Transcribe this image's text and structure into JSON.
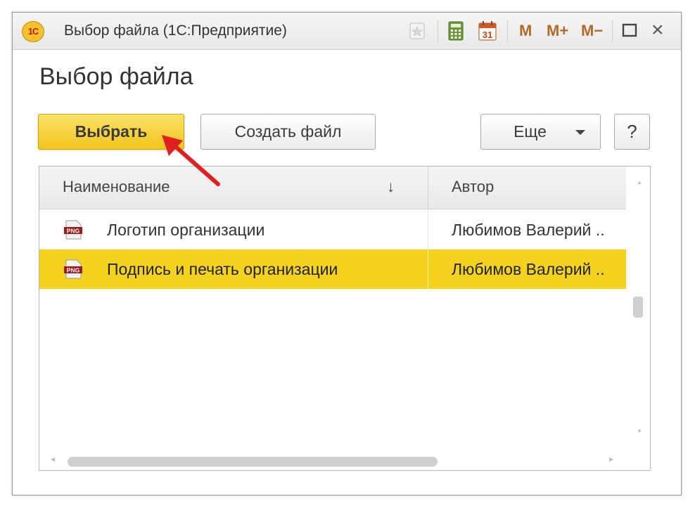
{
  "window": {
    "title": "Выбор файла (1С:Предприятие)",
    "app_logo_text": "1С",
    "memory_buttons": [
      "M",
      "M+",
      "M−"
    ],
    "calendar_day": "31",
    "icons": [
      "favorites-icon",
      "calculator-icon",
      "calendar-icon",
      "maximize-icon",
      "close-icon"
    ]
  },
  "page": {
    "title": "Выбор файла"
  },
  "toolbar": {
    "select_label": "Выбрать",
    "create_label": "Создать файл",
    "more_label": "Еще",
    "help_label": "?"
  },
  "table": {
    "columns": [
      "Наименование",
      "Автор"
    ],
    "sort_indicator": "↓",
    "rows": [
      {
        "icon": "png-file-icon",
        "name": "Логотип организации",
        "author": "Любимов Валерий ..",
        "selected": false
      },
      {
        "icon": "png-file-icon",
        "name": "Подпись и печать организации",
        "author": "Любимов Валерий ..",
        "selected": true
      }
    ]
  },
  "file_icon_label": "PNG",
  "colors": {
    "accent_yellow": "#f5d21d",
    "primary_button": "#f3c51a",
    "annotation_arrow": "#e02020"
  }
}
